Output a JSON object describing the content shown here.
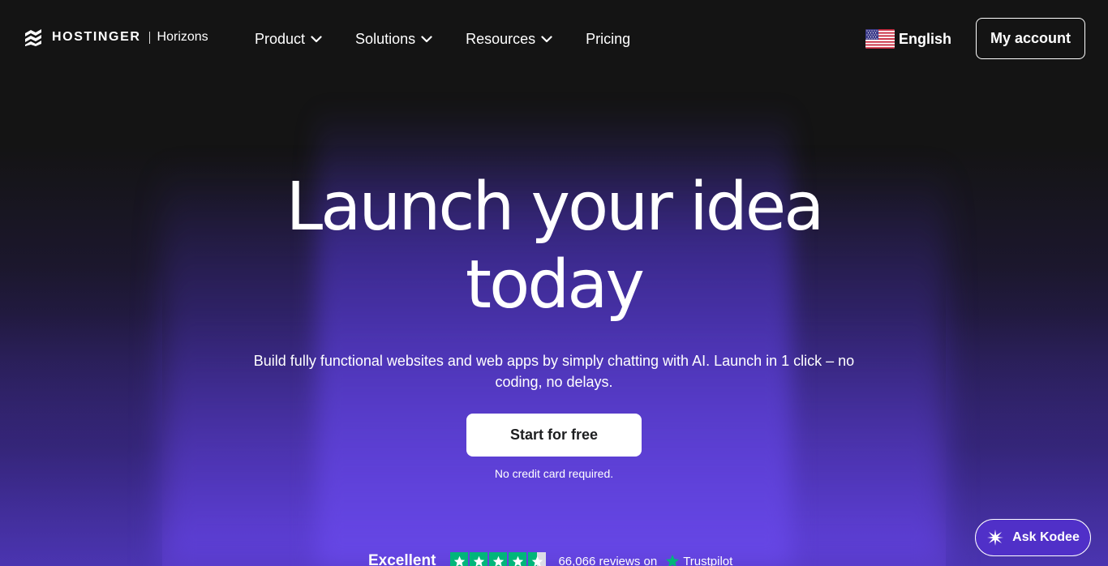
{
  "header": {
    "brand": "HOSTINGER",
    "product": "Horizons",
    "nav": [
      {
        "label": "Product",
        "has_dropdown": true
      },
      {
        "label": "Solutions",
        "has_dropdown": true
      },
      {
        "label": "Resources",
        "has_dropdown": true
      },
      {
        "label": "Pricing",
        "has_dropdown": false
      }
    ],
    "language": {
      "label": "English",
      "flag_icon": "us-flag-icon"
    },
    "account_label": "My account"
  },
  "hero": {
    "title_line1": "Launch your idea",
    "title_line2": "today",
    "subtitle": "Build fully functional websites and web apps by simply chatting with AI. Launch in 1 click – no coding, no delays.",
    "cta_label": "Start for free",
    "cta_note": "No credit card required."
  },
  "trust": {
    "rating_label": "Excellent",
    "stars": 4.5,
    "reviews": "66,066 reviews on",
    "provider": "Trustpilot"
  },
  "assistant": {
    "label": "Ask Kodee"
  },
  "colors": {
    "background": "#141414",
    "accent_purple": "#6a48e8",
    "trustpilot_green": "#00b67a",
    "cta_text": "#1d1e20"
  }
}
